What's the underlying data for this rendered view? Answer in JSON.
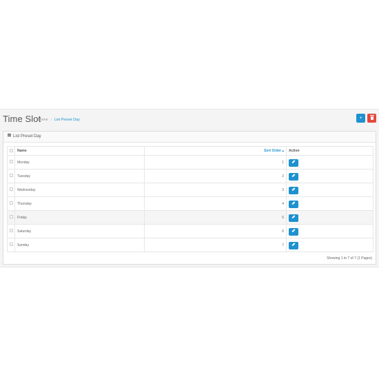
{
  "header": {
    "title": "Time Slot",
    "breadcrumb": [
      {
        "label": "Home"
      },
      {
        "label": "List Preset Day"
      }
    ],
    "breadcrumb_separator": "›",
    "add_icon": "plus-icon",
    "delete_icon": "trash-icon",
    "add_symbol": "+"
  },
  "panel": {
    "title": "List Preset Day",
    "title_icon": "list-icon"
  },
  "table": {
    "columns": {
      "name": "Name",
      "sort_order": "Sort Order",
      "sort_indicator": "▴",
      "action": "Action"
    },
    "rows": [
      {
        "name": "Monday",
        "sort_order": "1"
      },
      {
        "name": "Tuesday",
        "sort_order": "2"
      },
      {
        "name": "Wednesday",
        "sort_order": "3"
      },
      {
        "name": "Thursday",
        "sort_order": "4"
      },
      {
        "name": "Friday",
        "sort_order": "5"
      },
      {
        "name": "Saturday",
        "sort_order": "6"
      },
      {
        "name": "Sunday",
        "sort_order": "7"
      }
    ],
    "edit_icon": "pencil-icon"
  },
  "pagination": {
    "summary": "Showing 1 to 7 of 7 (1 Pages)"
  },
  "colors": {
    "primary": "#1e91cf",
    "danger": "#e4493e",
    "row_highlight": "#f5f5f5"
  }
}
